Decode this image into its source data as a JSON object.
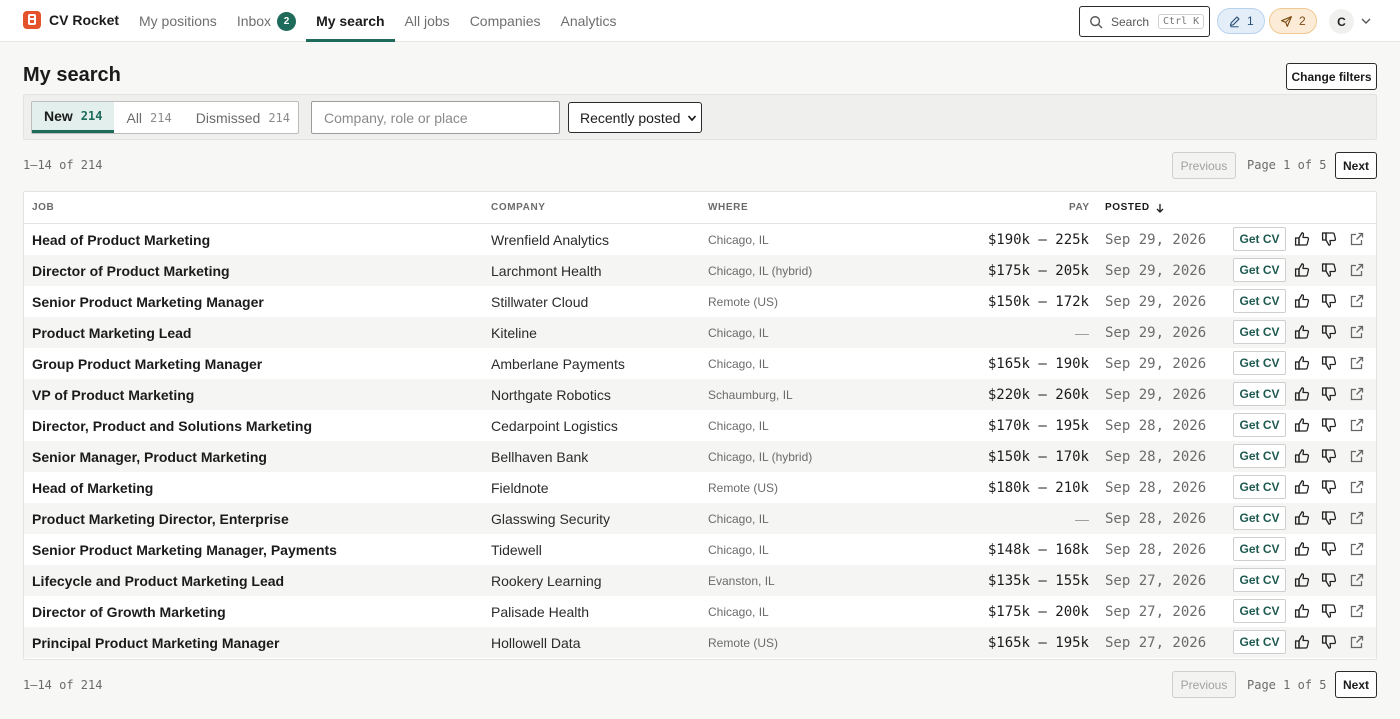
{
  "app": {
    "brand": "CV Rocket",
    "colors": {
      "accent": "#1e6b5c",
      "brand": "#e5532d"
    }
  },
  "nav": {
    "links": [
      {
        "label": "My positions"
      },
      {
        "label": "Inbox",
        "badge": "2"
      },
      {
        "label": "My search",
        "active": true
      },
      {
        "label": "All jobs"
      },
      {
        "label": "Companies"
      },
      {
        "label": "Analytics"
      }
    ],
    "search_label": "Search",
    "search_shortcut": "Ctrl K",
    "drafts_count": "1",
    "sent_count": "2",
    "avatar_initial": "C"
  },
  "page": {
    "title": "My search",
    "change_filters": "Change filters"
  },
  "filters": {
    "segments": [
      {
        "label": "New",
        "count": "214",
        "active": true
      },
      {
        "label": "All",
        "count": "214"
      },
      {
        "label": "Dismissed",
        "count": "214"
      }
    ],
    "query_placeholder": "Company, role or place",
    "sort_selected": "Recently posted"
  },
  "pager": {
    "range": "1–14 of 214",
    "previous": "Previous",
    "page_info": "Page 1 of 5",
    "next": "Next"
  },
  "table": {
    "headers": {
      "job": "JOB",
      "company": "COMPANY",
      "where": "WHERE",
      "pay": "PAY",
      "posted": "POSTED"
    },
    "get_cv_label": "Get CV",
    "rows": [
      {
        "job": "Head of Product Marketing",
        "company": "Wrenfield Analytics",
        "where": "Chicago, IL",
        "pay": "$190k – 225k",
        "posted": "Sep 29, 2026"
      },
      {
        "job": "Director of Product Marketing",
        "company": "Larchmont Health",
        "where": "Chicago, IL (hybrid)",
        "pay": "$175k – 205k",
        "posted": "Sep 29, 2026"
      },
      {
        "job": "Senior Product Marketing Manager",
        "company": "Stillwater Cloud",
        "where": "Remote (US)",
        "pay": "$150k – 172k",
        "posted": "Sep 29, 2026"
      },
      {
        "job": "Product Marketing Lead",
        "company": "Kiteline",
        "where": "Chicago, IL",
        "pay": "—",
        "posted": "Sep 29, 2026"
      },
      {
        "job": "Group Product Marketing Manager",
        "company": "Amberlane Payments",
        "where": "Chicago, IL",
        "pay": "$165k – 190k",
        "posted": "Sep 29, 2026"
      },
      {
        "job": "VP of Product Marketing",
        "company": "Northgate Robotics",
        "where": "Schaumburg, IL",
        "pay": "$220k – 260k",
        "posted": "Sep 29, 2026"
      },
      {
        "job": "Director, Product and Solutions Marketing",
        "company": "Cedarpoint Logistics",
        "where": "Chicago, IL",
        "pay": "$170k – 195k",
        "posted": "Sep 28, 2026"
      },
      {
        "job": "Senior Manager, Product Marketing",
        "company": "Bellhaven Bank",
        "where": "Chicago, IL (hybrid)",
        "pay": "$150k – 170k",
        "posted": "Sep 28, 2026"
      },
      {
        "job": "Head of Marketing",
        "company": "Fieldnote",
        "where": "Remote (US)",
        "pay": "$180k – 210k",
        "posted": "Sep 28, 2026"
      },
      {
        "job": "Product Marketing Director, Enterprise",
        "company": "Glasswing Security",
        "where": "Chicago, IL",
        "pay": "—",
        "posted": "Sep 28, 2026"
      },
      {
        "job": "Senior Product Marketing Manager, Payments",
        "company": "Tidewell",
        "where": "Chicago, IL",
        "pay": "$148k – 168k",
        "posted": "Sep 28, 2026"
      },
      {
        "job": "Lifecycle and Product Marketing Lead",
        "company": "Rookery Learning",
        "where": "Evanston, IL",
        "pay": "$135k – 155k",
        "posted": "Sep 27, 2026"
      },
      {
        "job": "Director of Growth Marketing",
        "company": "Palisade Health",
        "where": "Chicago, IL",
        "pay": "$175k – 200k",
        "posted": "Sep 27, 2026"
      },
      {
        "job": "Principal Product Marketing Manager",
        "company": "Hollowell Data",
        "where": "Remote (US)",
        "pay": "$165k – 195k",
        "posted": "Sep 27, 2026"
      }
    ]
  }
}
